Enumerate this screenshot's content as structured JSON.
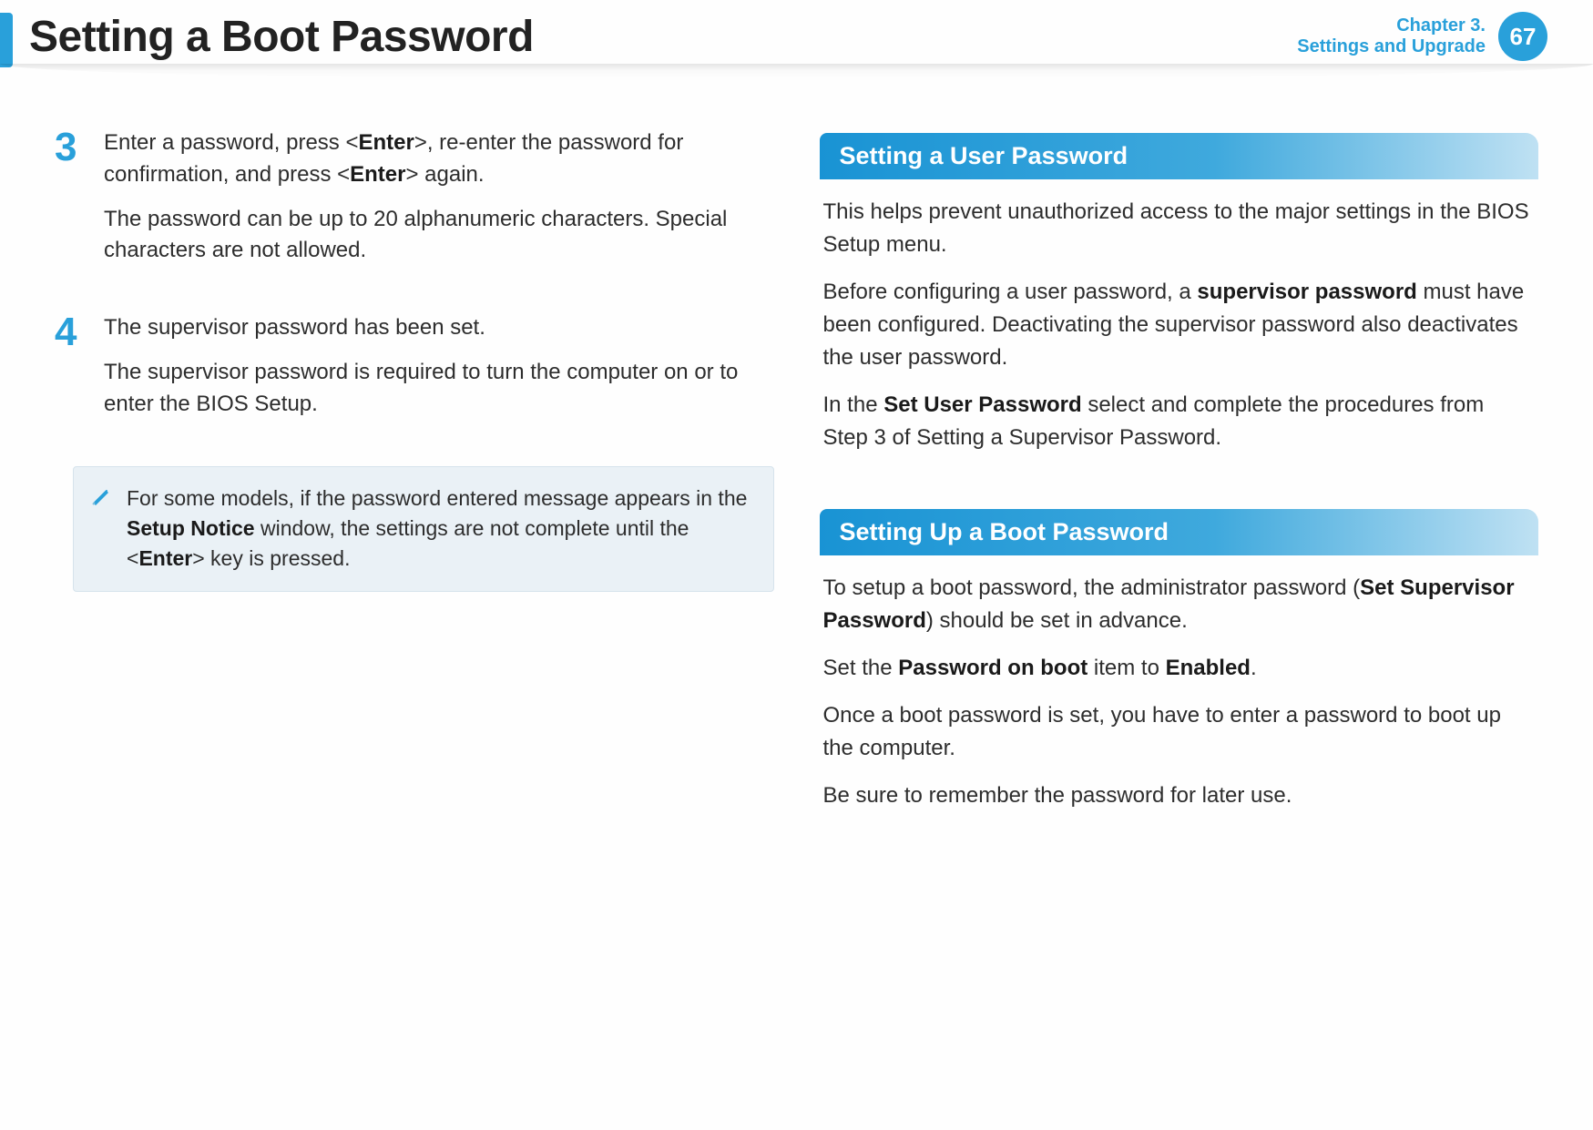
{
  "header": {
    "title": "Setting a Boot Password",
    "chapter_label": "Chapter 3.",
    "chapter_sub": "Settings and Upgrade",
    "page_number": "67"
  },
  "left": {
    "step3": {
      "num": "3",
      "p1_a": "Enter a password, press <",
      "p1_b": "Enter",
      "p1_c": ">, re-enter the password for confirmation, and press <",
      "p1_d": "Enter",
      "p1_e": "> again.",
      "p2": "The password can be up to 20 alphanumeric characters. Special characters are not allowed."
    },
    "step4": {
      "num": "4",
      "p1": "The supervisor password has been set.",
      "p2": "The supervisor password is required to turn the computer on or to enter the BIOS Setup."
    },
    "note": {
      "a": "For some models, if the password entered message appears in the ",
      "b": "Setup Notice",
      "c": " window, the settings are not complete until the <",
      "d": "Enter",
      "e": "> key is pressed."
    }
  },
  "right": {
    "user_pw": {
      "heading": "Setting a User Password",
      "p1": "This helps prevent unauthorized access to the major settings in the BIOS Setup menu.",
      "p2_a": "Before configuring a user password, a ",
      "p2_b": "supervisor password",
      "p2_c": " must have been configured. Deactivating the supervisor password also deactivates the user password.",
      "p3_a": "In the ",
      "p3_b": "Set User Password",
      "p3_c": " select and complete the procedures from Step 3 of Setting a Supervisor Password."
    },
    "boot_pw": {
      "heading": "Setting Up a Boot Password",
      "p1_a": "To setup a boot password, the administrator password (",
      "p1_b": "Set Supervisor Password",
      "p1_c": ") should be set in advance.",
      "p2_a": "Set the ",
      "p2_b": "Password on boot",
      "p2_c": " item to ",
      "p2_d": "Enabled",
      "p2_e": ".",
      "p3": "Once a boot password is set, you have to enter a password to boot up the computer.",
      "p4": "Be sure to remember the password for later use."
    }
  }
}
